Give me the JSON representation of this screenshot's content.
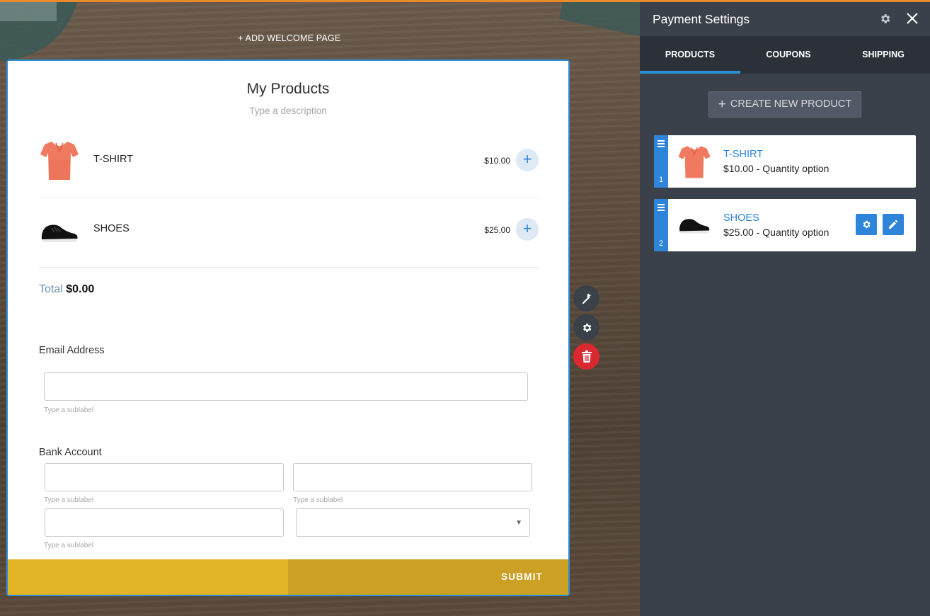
{
  "canvas": {
    "add_welcome_label": "+ ADD WELCOME PAGE"
  },
  "form": {
    "title": "My Products",
    "description_placeholder": "Type a description",
    "products": [
      {
        "name": "T-SHIRT",
        "price": "$10.00",
        "icon": "tshirt-icon"
      },
      {
        "name": "SHOES",
        "price": "$25.00",
        "icon": "shoe-icon"
      }
    ],
    "total_label": "Total",
    "total_value": "$0.00",
    "email_label": "Email Address",
    "email_value": "",
    "email_sublabel": "Type a sublabel",
    "bank_label": "Bank Account",
    "bank_sublabels": [
      "Type a sublabel",
      "Type a sublabel",
      "Type a sublabel"
    ],
    "submit_label": "SUBMIT",
    "submit_color": "#e3b327"
  },
  "tools": {
    "wand_icon": "magic-wand-icon",
    "settings_icon": "gear-icon",
    "delete_icon": "trash-icon"
  },
  "panel": {
    "title": "Payment Settings",
    "tabs": [
      {
        "label": "PRODUCTS",
        "active": true
      },
      {
        "label": "COUPONS",
        "active": false
      },
      {
        "label": "SHIPPING",
        "active": false
      }
    ],
    "create_label": "CREATE NEW PRODUCT",
    "products": [
      {
        "index": "1",
        "name": "T-SHIRT",
        "desc": "$10.00 - Quantity option"
      },
      {
        "index": "2",
        "name": "SHOES",
        "desc": "$25.00 - Quantity option"
      }
    ]
  },
  "colors": {
    "accent": "#2d84d8",
    "panel_bg": "#3b414a",
    "tabs_bg": "#2c3038",
    "delete_red": "#d9282f"
  }
}
